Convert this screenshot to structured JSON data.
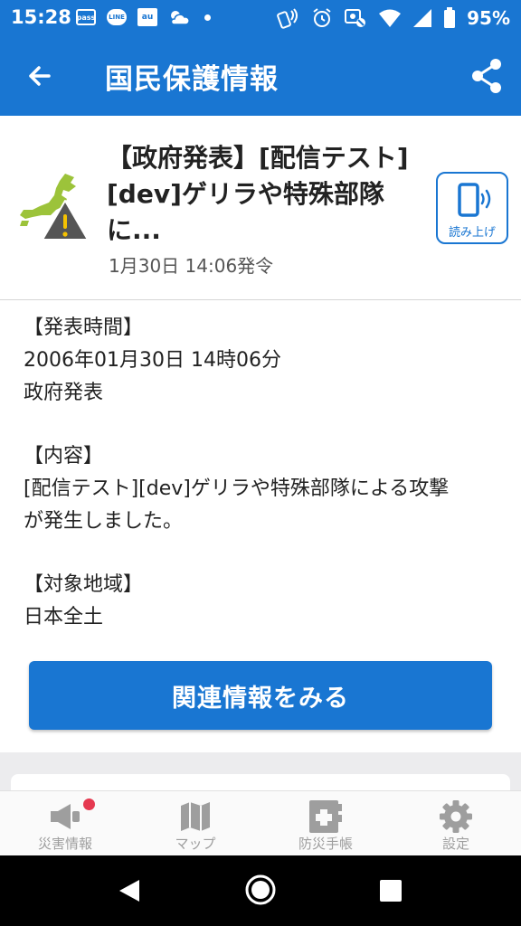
{
  "status_bar": {
    "time": "15:28",
    "battery": "95%",
    "left_icons": [
      "pass-icon",
      "line-icon",
      "au-icon",
      "weather-icon",
      "notification-dot-icon"
    ],
    "pass_text": "pass",
    "line_text": "LINE",
    "au_text": "au",
    "right_icons": [
      "nfc-icon",
      "alarm-icon",
      "location-off-icon",
      "wifi-icon",
      "signal-icon",
      "battery-icon"
    ]
  },
  "app_bar": {
    "title": "国民保護情報",
    "back_icon": "arrow-back-icon",
    "share_icon": "share-icon"
  },
  "alert": {
    "title": "【政府発表】[配信テスト][dev]ゲリラや特殊部隊に...",
    "date": "1月30日 14:06発令",
    "icon": "japan-warning-icon",
    "read_aloud_label": "読み上げ"
  },
  "body": {
    "lines": [
      "【発表時間】",
      "2006年01月30日 14時06分",
      "政府発表",
      "",
      "【内容】",
      "[配信テスト][dev]ゲリラや特殊部隊による攻撃",
      "が発生しました。",
      "",
      "【対象地域】",
      "日本全土"
    ]
  },
  "related_button": "関連情報をみる",
  "bottom_nav": [
    {
      "label": "災害情報",
      "icon": "megaphone-icon",
      "badge": true
    },
    {
      "label": "マップ",
      "icon": "map-icon",
      "badge": false
    },
    {
      "label": "防災手帳",
      "icon": "first-aid-book-icon",
      "badge": false
    },
    {
      "label": "設定",
      "icon": "gear-icon",
      "badge": false
    }
  ],
  "colors": {
    "primary": "#1976d2",
    "badge": "#e53950",
    "nav_inactive": "#9e9e9e",
    "japan_green": "#9cc33a",
    "warning_gray": "#555555",
    "warning_yellow": "#f5c200"
  }
}
